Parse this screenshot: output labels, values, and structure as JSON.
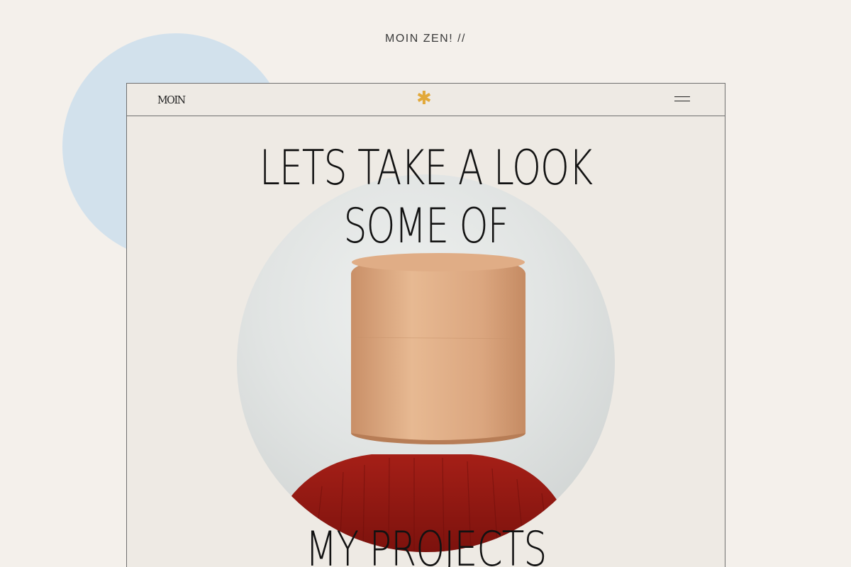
{
  "caption": "MOIN ZEN! //",
  "nav": {
    "logo": "MOIN",
    "center_symbol": "✱",
    "menu_icon": "hamburger-menu-icon"
  },
  "hero": {
    "line1": "LETS TAKE A LOOK",
    "line2": "SOME OF",
    "line3": "MY PROJECTS"
  },
  "colors": {
    "background": "#f4f0eb",
    "accent_circle": "#d2e1ec",
    "asterisk": "#e2a93a"
  }
}
